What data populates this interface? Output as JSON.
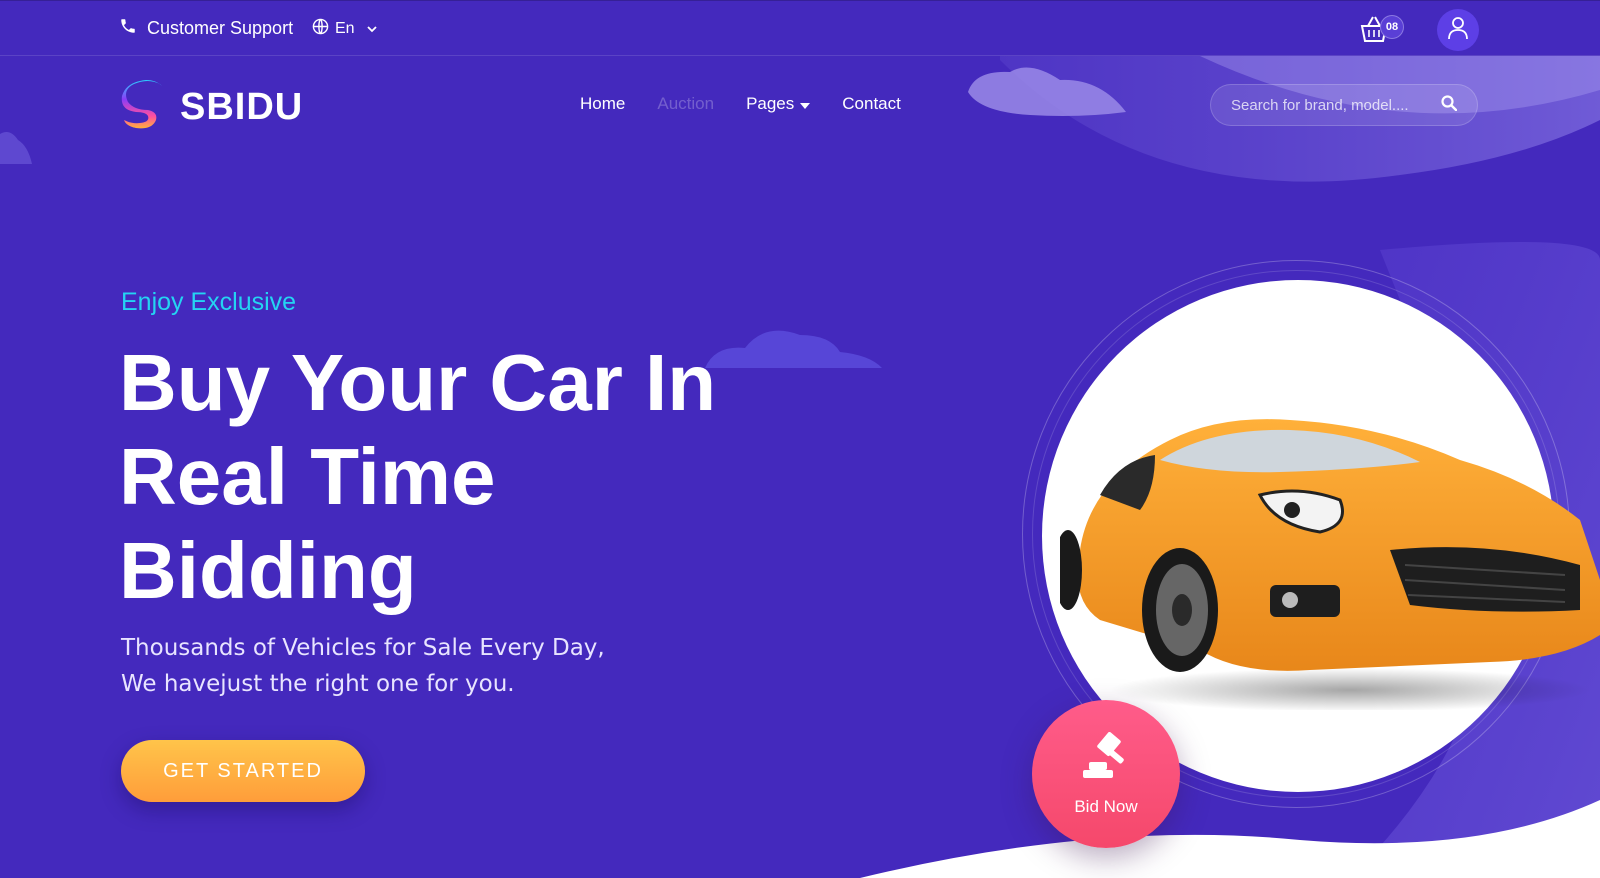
{
  "topbar": {
    "support_label": "Customer Support",
    "language": "En",
    "cart_count": "08"
  },
  "header": {
    "logo_text": "SBIDU",
    "nav": [
      {
        "label": "Home",
        "active": false
      },
      {
        "label": "Auction",
        "active": true
      },
      {
        "label": "Pages",
        "dropdown": true
      },
      {
        "label": "Contact"
      }
    ],
    "search_placeholder": "Search for brand, model...."
  },
  "hero": {
    "eyebrow": "Enjoy Exclusive",
    "headline_line1": "Buy Your Car In",
    "headline_line2": "Real Time",
    "headline_line3": "Bidding",
    "subtext": "Thousands of Vehicles for Sale Every Day, We havejust the right one for you.",
    "cta_label": "GET STARTED",
    "bid_label": "Bid Now"
  },
  "colors": {
    "background": "#4429bd",
    "accent_cyan": "#24d4f2",
    "cta_gradient_top": "#ffc44a",
    "cta_gradient_bottom": "#ff9d3a",
    "bid_pink": "#f5486b"
  },
  "icons": [
    "phone-icon",
    "globe-icon",
    "chevron-down-icon",
    "cart-icon",
    "user-icon",
    "search-icon",
    "gavel-icon"
  ]
}
